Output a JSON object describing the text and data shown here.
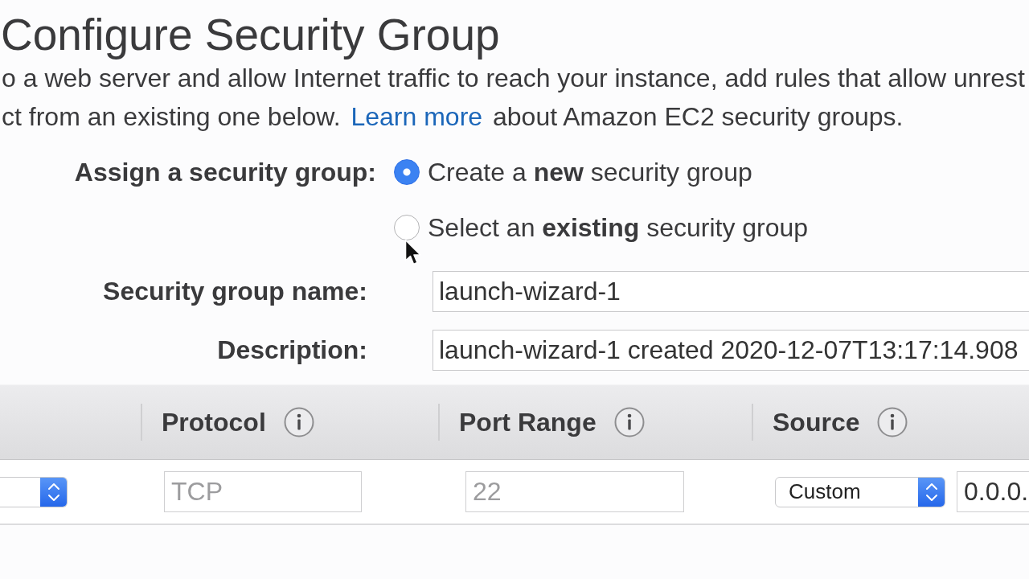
{
  "page": {
    "title": "Configure Security Group",
    "intro": [
      {
        "text": "o a web server and allow Internet traffic to reach your instance, add rules that allow unrest"
      },
      {
        "text": "ct from an existing one below.",
        "link": "Learn more",
        "after": "about Amazon EC2 security groups."
      }
    ]
  },
  "assign": {
    "label": "Assign a security group:",
    "options": [
      {
        "label": "Create a **new** security group",
        "selected": true
      },
      {
        "label": "Select an **existing** security group",
        "selected": false
      }
    ]
  },
  "fields": [
    {
      "label": "Security group name:",
      "value": "launch-wizard-1"
    },
    {
      "label": "Description:",
      "value": "launch-wizard-1 created 2020-12-07T13:17:14.908"
    }
  ],
  "rules_table": {
    "columns": [
      {
        "kind": "blank"
      },
      {
        "kind": "heading",
        "label": "Protocol"
      },
      {
        "kind": "heading",
        "label": "Port Range"
      },
      {
        "kind": "heading",
        "label": "Source"
      }
    ],
    "rows": [
      {
        "cells": [
          [
            {
              "kind": "select"
            }
          ],
          [
            {
              "kind": "input",
              "value": "TCP",
              "disabled": true
            }
          ],
          [
            {
              "kind": "input",
              "value": "22",
              "disabled": true
            }
          ],
          [
            {
              "kind": "select",
              "value": "Custom"
            },
            {
              "kind": "input",
              "value": "0.0.0.",
              "disabled": false
            }
          ]
        ]
      }
    ]
  }
}
